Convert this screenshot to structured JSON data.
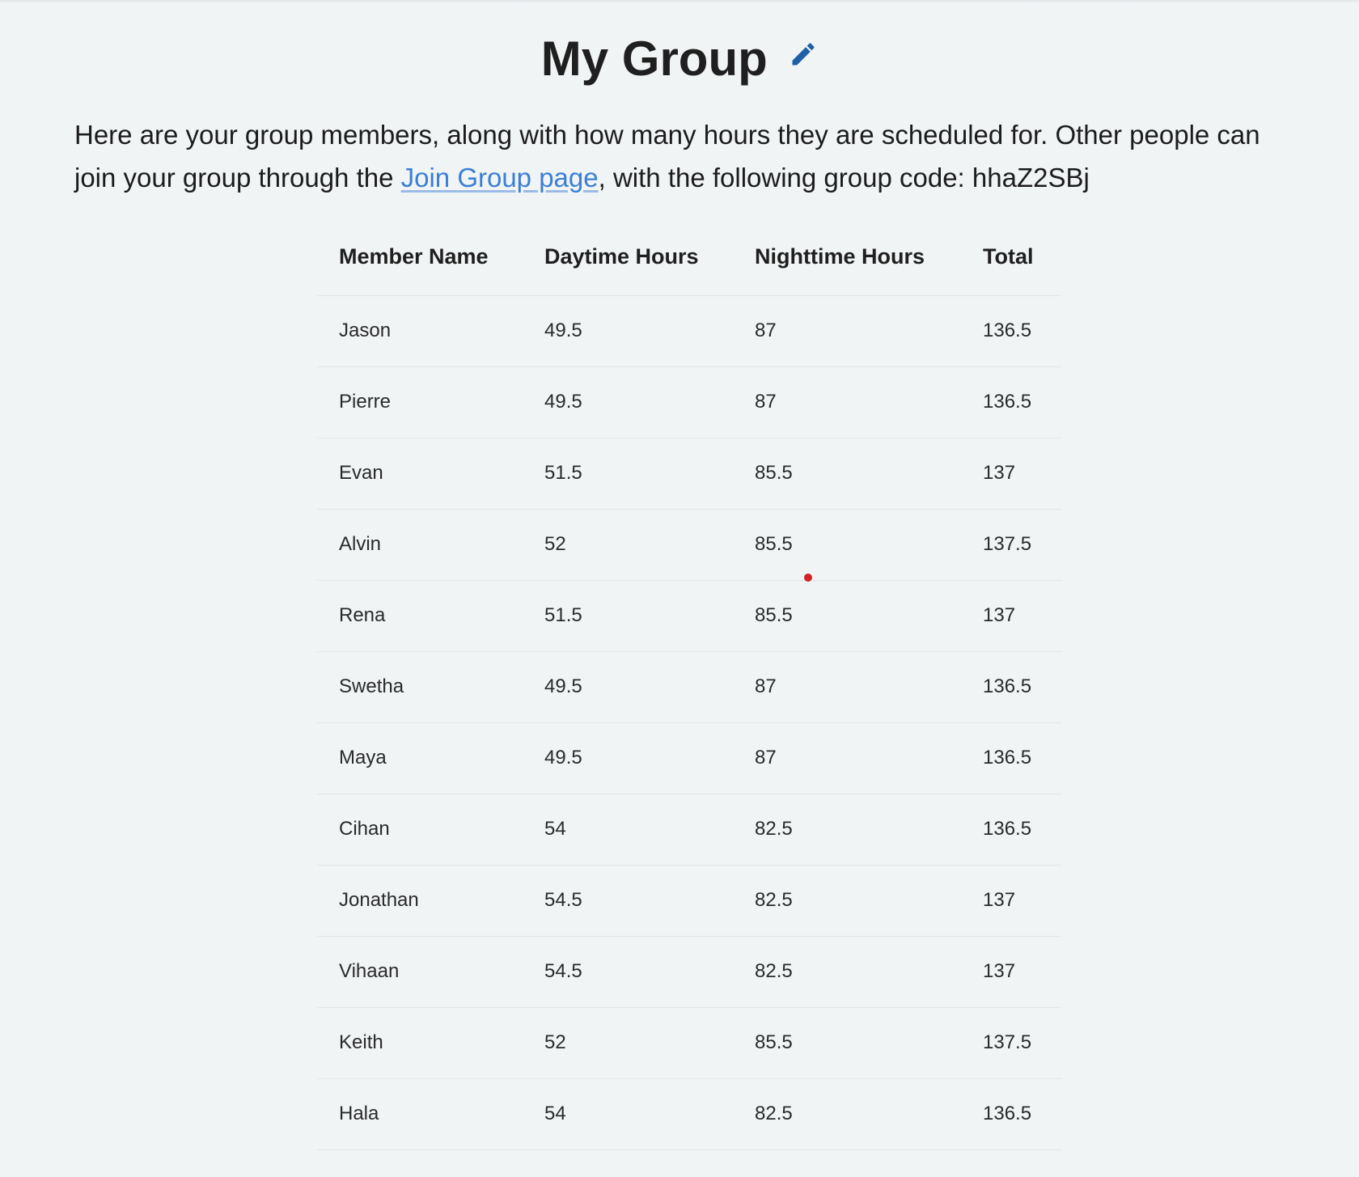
{
  "header": {
    "title": "My Group",
    "edit_icon": "pencil-icon",
    "accent_color": "#1f5fa8"
  },
  "intro": {
    "text_before_link": "Here are your group members, along with how many hours they are scheduled for. Other people can join your group through the ",
    "link_label": "Join Group page",
    "text_after_link": ", with the following group code: ",
    "group_code": "hhaZ2SBj",
    "link_color": "#3b7fd4"
  },
  "table": {
    "headers": [
      "Member Name",
      "Daytime Hours",
      "Nighttime Hours",
      "Total"
    ],
    "rows": [
      [
        "Jason",
        "49.5",
        "87",
        "136.5"
      ],
      [
        "Pierre",
        "49.5",
        "87",
        "136.5"
      ],
      [
        "Evan",
        "51.5",
        "85.5",
        "137"
      ],
      [
        "Alvin",
        "52",
        "85.5",
        "137.5"
      ],
      [
        "Rena",
        "51.5",
        "85.5",
        "137"
      ],
      [
        "Swetha",
        "49.5",
        "87",
        "136.5"
      ],
      [
        "Maya",
        "49.5",
        "87",
        "136.5"
      ],
      [
        "Cihan",
        "54",
        "82.5",
        "136.5"
      ],
      [
        "Jonathan",
        "54.5",
        "82.5",
        "137"
      ],
      [
        "Vihaan",
        "54.5",
        "82.5",
        "137"
      ],
      [
        "Keith",
        "52",
        "85.5",
        "137.5"
      ],
      [
        "Hala",
        "54",
        "82.5",
        "136.5"
      ]
    ]
  }
}
